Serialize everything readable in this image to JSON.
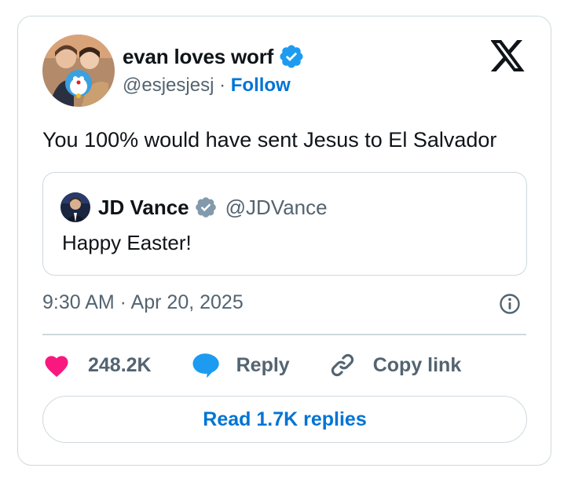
{
  "tweet": {
    "author": {
      "display_name": "evan loves worf",
      "handle": "@esjesjesj",
      "separator": "·",
      "follow_label": "Follow",
      "avatar_icon": "avatar-photo",
      "verified_icon": "verified-badge-icon"
    },
    "brand_icon": "x-logo-icon",
    "text": "You 100% would have sent Jesus to El Salvador",
    "quoted": {
      "display_name": "JD Vance",
      "handle": "@JDVance",
      "text": "Happy Easter!",
      "verified_icon": "verified-gray-badge-icon"
    },
    "timestamp": "9:30 AM · Apr 20, 2025",
    "info_icon": "info-icon",
    "actions": {
      "likes_count": "248.2K",
      "reply_label": "Reply",
      "copy_link_label": "Copy link"
    },
    "read_replies_label": "Read 1.7K replies"
  },
  "colors": {
    "accent": "#0074d4",
    "verified": "#1d9bf0",
    "heart": "#f91880",
    "muted_text": "#536471",
    "border": "#cfd9de"
  }
}
